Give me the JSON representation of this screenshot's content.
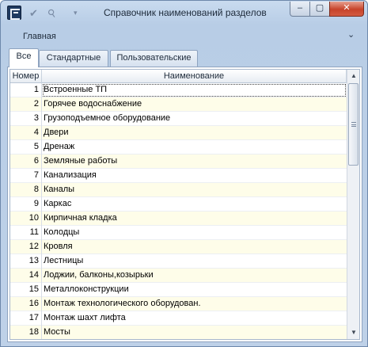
{
  "window": {
    "title": "Справочник наименований разделов",
    "icons": [
      "app-logo-icon",
      "check-icon",
      "paperclip-icon",
      "dropdown-icon"
    ],
    "controls": {
      "minimize": "‒",
      "maximize": "▢",
      "close": "✕"
    }
  },
  "ribbon": {
    "tab_label": "Главная",
    "collapse_icon": "⌄"
  },
  "tabs": [
    {
      "label": "Все",
      "active": true
    },
    {
      "label": "Стандартные",
      "active": false
    },
    {
      "label": "Пользовательские",
      "active": false
    }
  ],
  "grid": {
    "columns": [
      "Номер",
      "Наименование"
    ],
    "rows": [
      {
        "num": "1",
        "name": "Встроенные ТП"
      },
      {
        "num": "2",
        "name": "Горячее водоснабжение"
      },
      {
        "num": "3",
        "name": "Грузоподъемное оборудование"
      },
      {
        "num": "4",
        "name": "Двери"
      },
      {
        "num": "5",
        "name": "Дренаж"
      },
      {
        "num": "6",
        "name": "Земляные работы"
      },
      {
        "num": "7",
        "name": "Канализация"
      },
      {
        "num": "8",
        "name": "Каналы"
      },
      {
        "num": "9",
        "name": "Каркас"
      },
      {
        "num": "10",
        "name": "Кирпичная кладка"
      },
      {
        "num": "11",
        "name": "Колодцы"
      },
      {
        "num": "12",
        "name": "Кровля"
      },
      {
        "num": "13",
        "name": "Лестницы"
      },
      {
        "num": "14",
        "name": "Лоджии, балконы,козырьки"
      },
      {
        "num": "15",
        "name": "Металлоконструкции"
      },
      {
        "num": "16",
        "name": "Монтаж технологического оборудован."
      },
      {
        "num": "17",
        "name": "Монтаж шахт лифта"
      },
      {
        "num": "18",
        "name": "Мосты"
      }
    ],
    "selected_row": 0
  },
  "scrollbar": {
    "up": "▲",
    "down": "▼"
  }
}
